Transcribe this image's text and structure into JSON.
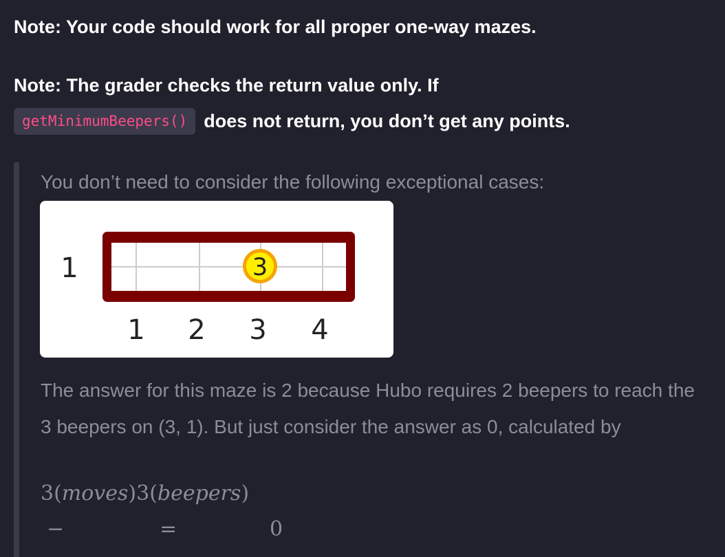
{
  "notes": {
    "note1": "Note: Your code should work for all proper one-way mazes.",
    "note2_part1": "Note: The grader checks the return value only. If",
    "note2_code": "getMinimumBeepers()",
    "note2_part2": "does not return, you don’t get any points."
  },
  "blockquote": {
    "intro": "You don’t need to consider the following exceptional cases:",
    "figure": {
      "row_label": "1",
      "col_labels": [
        "1",
        "2",
        "3",
        "4"
      ],
      "beeper_count": "3",
      "beeper_position": [
        3,
        1
      ],
      "colors": {
        "wall": "#7a0000",
        "grid": "#cccccc",
        "beeper_fill": "#ffee00",
        "beeper_ring": "#f5a400"
      }
    },
    "explanation": "The answer for this maze is 2 because Hubo requires 2 beepers to reach the 3 beepers on (3, 1). But just consider the answer as 0, calculated by",
    "math": {
      "line1_a": "3(",
      "line1_b": "moves",
      "line1_c": ")3(",
      "line1_d": "beepers",
      "line1_e": ")",
      "minus": "−",
      "equals": "=",
      "result": "0"
    }
  }
}
